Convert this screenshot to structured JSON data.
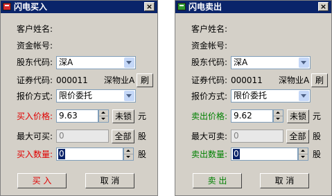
{
  "buy": {
    "title": "闪电买入",
    "close": "×",
    "customer_label": "客户姓名:",
    "account_label": "资金帐号:",
    "holder_label": "股东代码:",
    "holder_value": "深A",
    "code_label": "证券代码:",
    "code_value": "000011",
    "stock_name": "深物业A",
    "refresh_button": "刷",
    "price_type_label": "报价方式:",
    "price_type_value": "限价委托",
    "price_label": "买入价格:",
    "price_value": "9.63",
    "lock_button": "未锁",
    "price_unit": "元",
    "max_label": "最大可买:",
    "max_value": "0",
    "all_button": "全部",
    "max_unit": "股",
    "qty_label": "买入数量:",
    "qty_value": "0",
    "qty_unit": "股",
    "submit_button": "买 入",
    "cancel_button": "取 消"
  },
  "sell": {
    "title": "闪电卖出",
    "close": "×",
    "customer_label": "客户姓名:",
    "account_label": "资金帐号:",
    "holder_label": "股东代码:",
    "holder_value": "深A",
    "code_label": "证券代码:",
    "code_value": "000011",
    "stock_name": "深物业A",
    "refresh_button": "刷",
    "price_type_label": "报价方式:",
    "price_type_value": "限价委托",
    "price_label": "卖出价格:",
    "price_value": "9.62",
    "lock_button": "未锁",
    "price_unit": "元",
    "max_label": "最大可卖:",
    "max_value": "0",
    "all_button": "全部",
    "max_unit": "股",
    "qty_label": "卖出数量:",
    "qty_value": "0",
    "qty_unit": "股",
    "submit_button": "卖 出",
    "cancel_button": "取 消"
  },
  "colors": {
    "buy_accent": "#e00000",
    "sell_accent": "#008000",
    "titlebar": "#0a246a",
    "dialog_bg": "#d4d0c8"
  }
}
